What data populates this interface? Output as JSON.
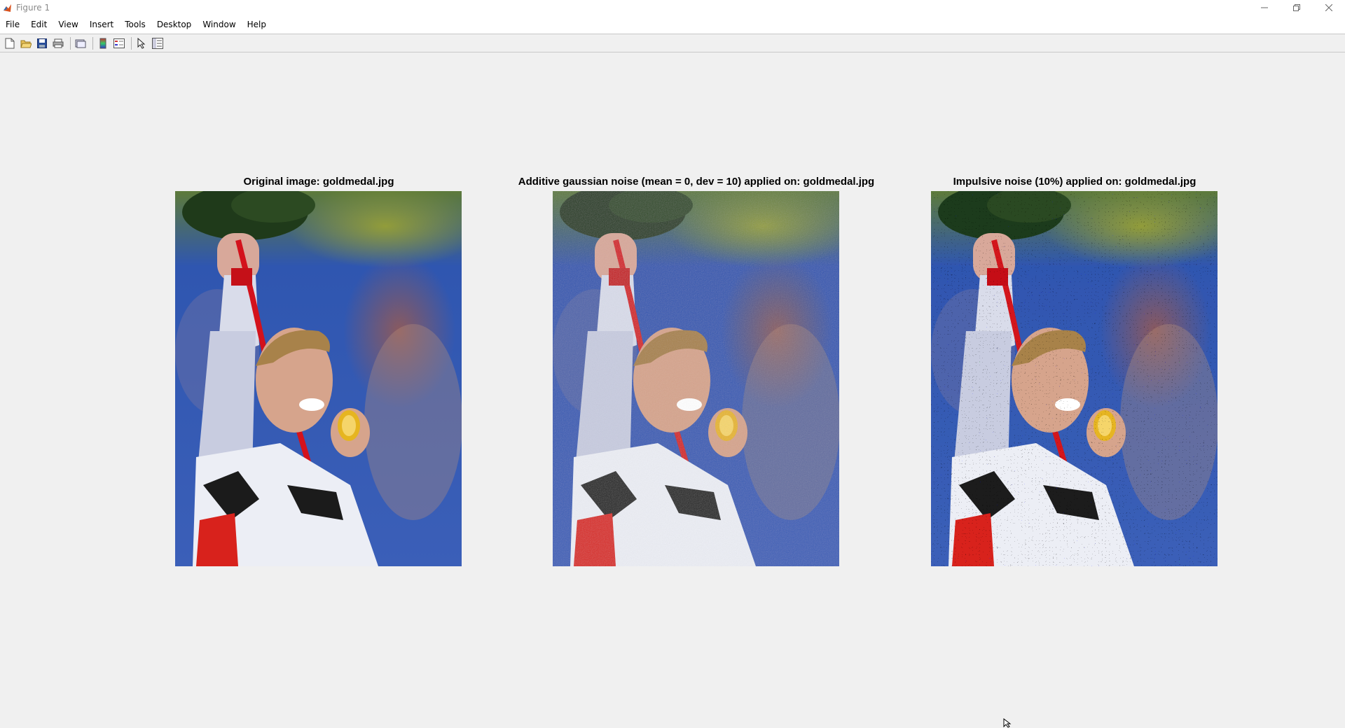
{
  "window": {
    "title": "Figure 1",
    "app_icon": "matlab-icon",
    "controls": [
      "minimize-icon",
      "restore-icon",
      "close-icon"
    ]
  },
  "menubar": {
    "items": [
      "File",
      "Edit",
      "View",
      "Insert",
      "Tools",
      "Desktop",
      "Window",
      "Help"
    ]
  },
  "toolbar": {
    "buttons": [
      "new-figure-icon",
      "open-file-icon",
      "save-icon",
      "print-icon",
      "link-plot-icon",
      "insert-colorbar-icon",
      "insert-legend-icon",
      "edit-plot-icon",
      "property-inspector-icon"
    ]
  },
  "axes": [
    {
      "title": "Original image: goldmedal.jpg",
      "image": "athlete holding gold medal",
      "noise": "none"
    },
    {
      "title": "Additive gaussian noise (mean = 0, dev = 10) applied on: goldmedal.jpg",
      "image": "athlete holding gold medal",
      "noise": "gaussian"
    },
    {
      "title": "Impulsive noise (10%) applied on: goldmedal.jpg",
      "image": "athlete holding gold medal",
      "noise": "impulsive"
    }
  ]
}
